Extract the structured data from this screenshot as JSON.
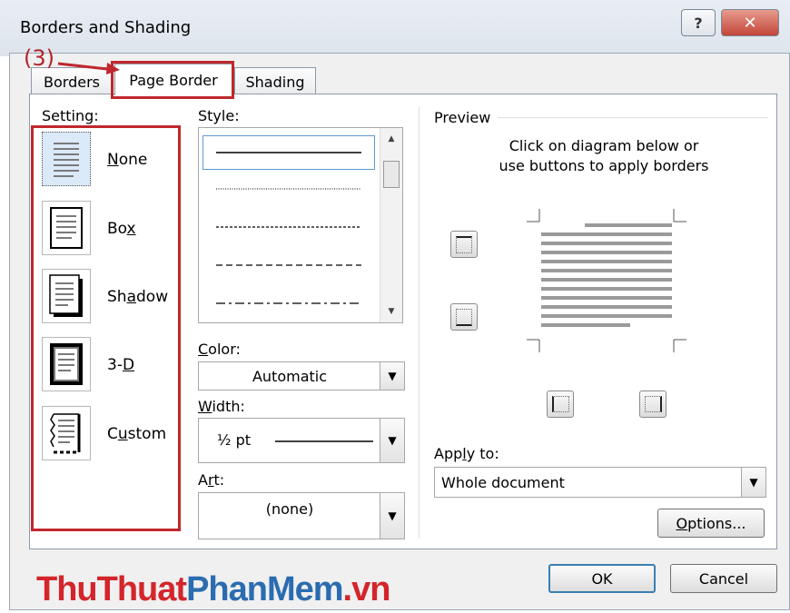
{
  "window": {
    "title": "Borders and Shading",
    "help_glyph": "?",
    "close_glyph": "✕"
  },
  "annotation": {
    "label": "(3)",
    "color": "#c0272d"
  },
  "tabs": [
    {
      "label": "Borders",
      "selected": false
    },
    {
      "label": "Page Border",
      "selected": true
    },
    {
      "label": "Shading",
      "selected": false
    }
  ],
  "setting": {
    "label": "Setting:",
    "items": [
      {
        "label": "None",
        "icon": "setting-none-icon",
        "selected": true
      },
      {
        "label": "Box",
        "icon": "setting-box-icon",
        "selected": false
      },
      {
        "label": "Shadow",
        "icon": "setting-shadow-icon",
        "selected": false
      },
      {
        "label": "3-D",
        "icon": "setting-3d-icon",
        "selected": false
      },
      {
        "label": "Custom",
        "icon": "setting-custom-icon",
        "selected": false
      }
    ]
  },
  "style": {
    "label": "Style:",
    "options": [
      "solid",
      "dotted",
      "fine-dashed",
      "dashed",
      "dash-dot"
    ],
    "selected": "solid"
  },
  "color": {
    "label": "Color:",
    "value": "Automatic"
  },
  "width": {
    "label": "Width:",
    "value": "½ pt"
  },
  "art": {
    "label": "Art:",
    "value": "(none)"
  },
  "preview": {
    "label": "Preview",
    "instruction_line1": "Click on diagram below or",
    "instruction_line2": "use buttons to apply borders"
  },
  "apply_to": {
    "label": "Apply to:",
    "value": "Whole document"
  },
  "buttons": {
    "options": "Options...",
    "ok": "OK",
    "cancel": "Cancel"
  },
  "watermark": {
    "part1": "ThuThuat",
    "part2": "PhanMem",
    "part3": ".vn"
  }
}
